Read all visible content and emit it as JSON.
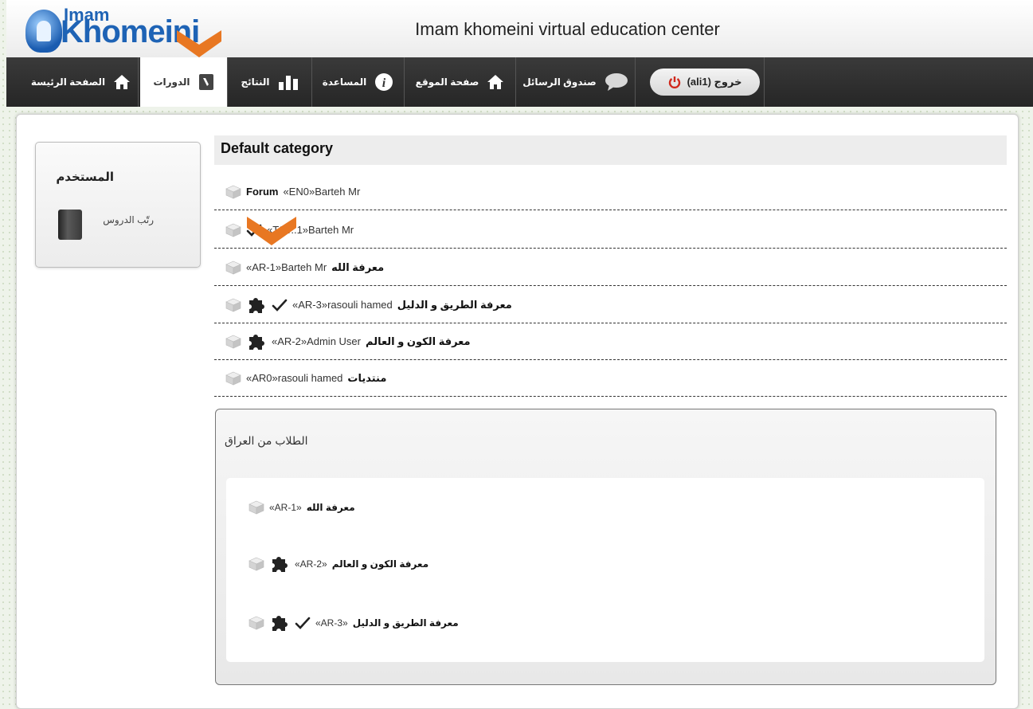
{
  "header": {
    "site_title": "Imam khomeini virtual education center",
    "logo_small": "Imam",
    "logo_big": "Khomeini"
  },
  "nav": {
    "home": "الصفحة الرئيسة",
    "courses": "الدورات",
    "results": "النتائج",
    "help": "المساعدة",
    "site_page": "صفحة الموقع",
    "messages": "صندوق الرسائل",
    "logout": "(ali1) خروج"
  },
  "sidebar": {
    "title": "المستخدم",
    "link": "رتّب الدروس"
  },
  "category": {
    "title": "Default category",
    "courses": [
      {
        "name": "Forum",
        "code": "«EN0»",
        "teacher": "Barteh Mr",
        "check": false,
        "puzzle": false,
        "rtl": false
      },
      {
        "name": "",
        "code": "«TST..1»",
        "teacher": "Barteh Mr",
        "check": true,
        "puzzle": false,
        "rtl": true
      },
      {
        "name": "معرفة الله",
        "code": "«AR-1»",
        "teacher": "Barteh Mr",
        "check": false,
        "puzzle": false,
        "rtl": true
      },
      {
        "name": "معرفة الطريق و الدليل",
        "code": "«AR-3»",
        "teacher": "rasouli hamed",
        "check": true,
        "puzzle": true,
        "rtl": true
      },
      {
        "name": "معرفة الكون و العالم",
        "code": "«AR-2»",
        "teacher": "Admin User",
        "check": false,
        "puzzle": true,
        "rtl": true
      },
      {
        "name": "منتديات",
        "code": "«AR0»",
        "teacher": "rasouli hamed",
        "check": false,
        "puzzle": false,
        "rtl": true
      }
    ]
  },
  "subcategory": {
    "title": "الطلاب من العراق",
    "courses": [
      {
        "name": "معرفة الله",
        "code": "«AR-1»",
        "check": false,
        "puzzle": false
      },
      {
        "name": "معرفة الكون و العالم",
        "code": "«AR-2»",
        "check": false,
        "puzzle": true
      },
      {
        "name": "معرفة الطريق و الدليل",
        "code": "«AR-3»",
        "check": true,
        "puzzle": true
      }
    ]
  },
  "colors": {
    "accent": "#e87722",
    "brand": "#1e63b5",
    "nav_bg": "#2e2e2e",
    "logout_icon": "#d0281c"
  }
}
